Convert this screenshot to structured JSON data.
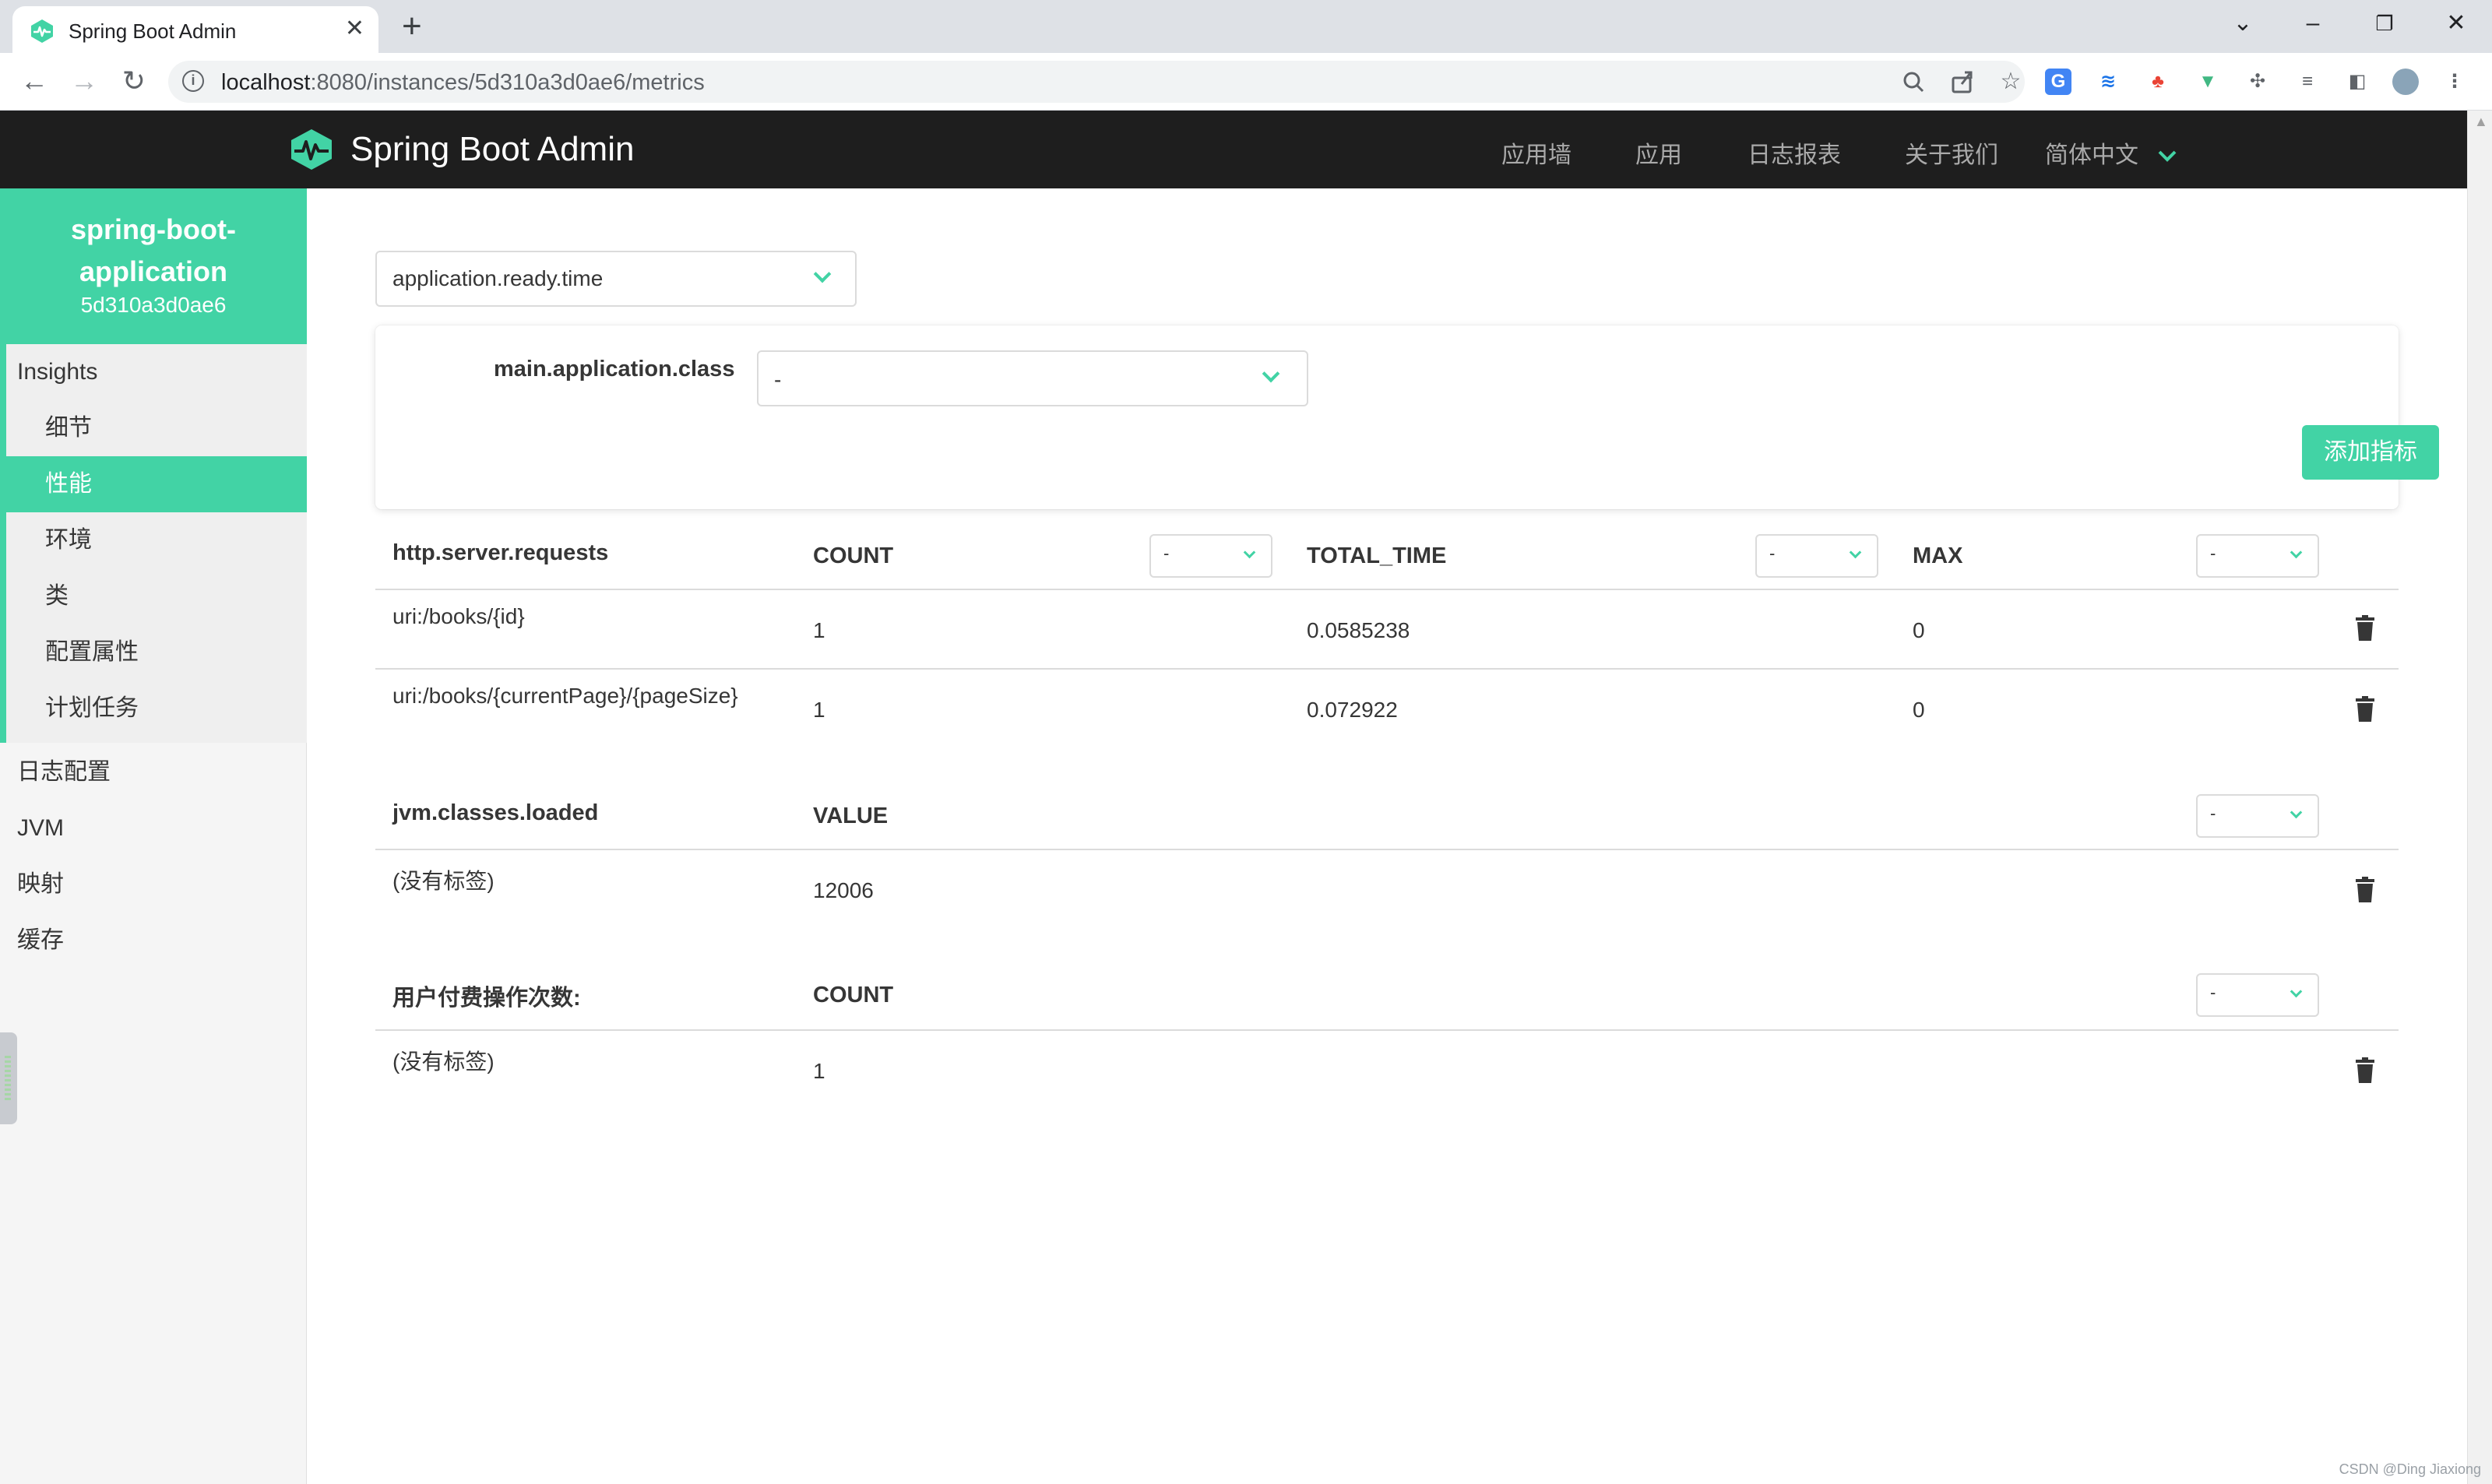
{
  "browser": {
    "tab_title": "Spring Boot Admin",
    "tab_close": "✕",
    "new_tab": "+",
    "url_host": "localhost",
    "url_path": ":8080/instances/5d310a3d0ae6/metrics",
    "win_minimize": "–",
    "win_restore": "❐",
    "win_close": "✕",
    "win_list": "⌄"
  },
  "navbar": {
    "brand": "Spring Boot Admin",
    "items": [
      "应用墙",
      "应用",
      "日志报表",
      "关于我们"
    ],
    "language": "简体中文"
  },
  "sidebar": {
    "app_name_line1": "spring-boot-",
    "app_name_line2": "application",
    "app_id": "5d310a3d0ae6",
    "group_title": "Insights",
    "group_items": [
      "细节",
      "性能",
      "环境",
      "类",
      "配置属性",
      "计划任务"
    ],
    "active_item": "性能",
    "top_items": [
      "日志配置",
      "JVM",
      "映射",
      "缓存"
    ]
  },
  "main": {
    "metric_select_value": "application.ready.time",
    "tag_label": "main.application.class",
    "tag_select_value": "-",
    "add_button": "添加指标",
    "tables": [
      {
        "name": "http.server.requests",
        "columns": [
          {
            "label": "COUNT",
            "unit": "-"
          },
          {
            "label": "TOTAL_TIME",
            "unit": "-"
          },
          {
            "label": "MAX",
            "unit": "-"
          }
        ],
        "rows": [
          {
            "tag": "uri:/books/{id}",
            "values": [
              "1",
              "0.0585238",
              "0"
            ]
          },
          {
            "tag": "uri:/books/{currentPage}/{pageSize}",
            "values": [
              "1",
              "0.072922",
              "0"
            ]
          }
        ]
      },
      {
        "name": "jvm.classes.loaded",
        "columns": [
          {
            "label": "VALUE",
            "unit": "-"
          }
        ],
        "rows": [
          {
            "tag": "(没有标签)",
            "values": [
              "12006"
            ]
          }
        ]
      },
      {
        "name": "用户付费操作次数:",
        "columns": [
          {
            "label": "COUNT",
            "unit": "-"
          }
        ],
        "rows": [
          {
            "tag": "(没有标签)",
            "values": [
              "1"
            ]
          }
        ]
      }
    ]
  },
  "watermark": "CSDN @Ding Jiaxiong",
  "colors": {
    "accent": "#42d3a5",
    "navbar_bg": "#1e1e1e",
    "sidebar_bg": "#f5f5f5",
    "text": "#363636"
  }
}
